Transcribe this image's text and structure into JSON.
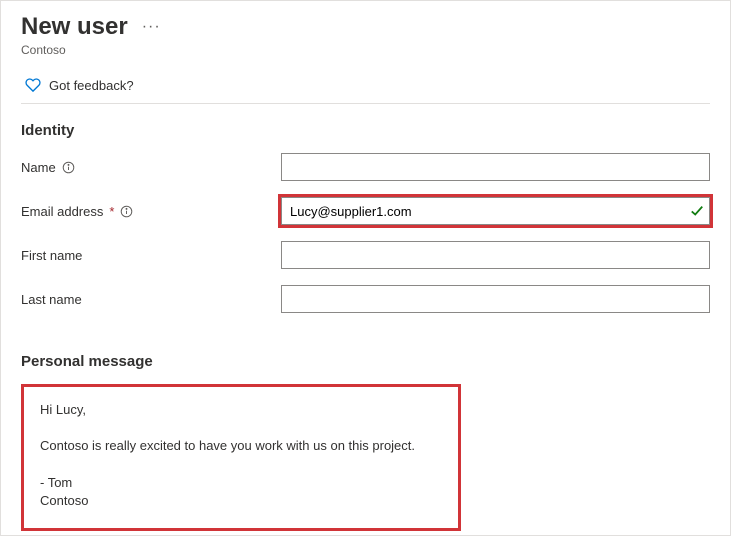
{
  "header": {
    "title": "New user",
    "org": "Contoso",
    "feedback_label": "Got feedback?"
  },
  "sections": {
    "identity_title": "Identity",
    "personal_message_title": "Personal message"
  },
  "form": {
    "name_label": "Name",
    "name_value": "",
    "email_label": "Email address",
    "email_value": "Lucy@supplier1.com",
    "firstname_label": "First name",
    "firstname_value": "",
    "lastname_label": "Last name",
    "lastname_value": ""
  },
  "message": "Hi Lucy,\n\nContoso is really excited to have you work with us on this project.\n\n- Tom\nContoso",
  "highlight_color": "#d13438"
}
